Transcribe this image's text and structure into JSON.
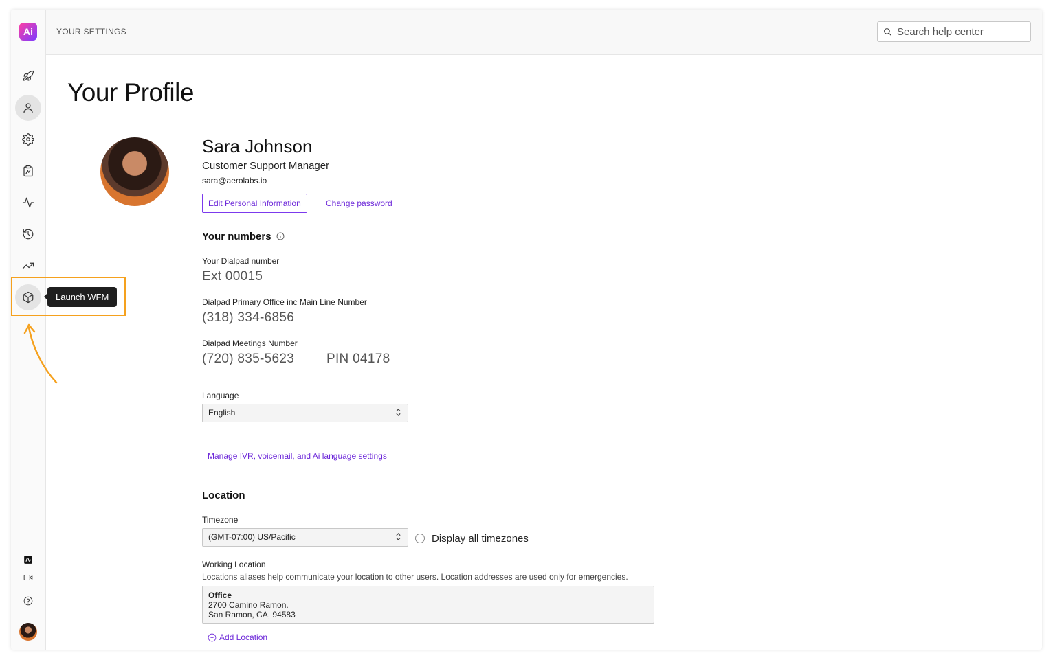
{
  "topbar": {
    "breadcrumb": "YOUR SETTINGS",
    "search_placeholder": "Search help center"
  },
  "sidebar": {
    "logo": "Ai",
    "items": [
      {
        "icon": "rocket-icon"
      },
      {
        "icon": "user-icon",
        "active": true
      },
      {
        "icon": "gear-icon"
      },
      {
        "icon": "clipboard-icon"
      },
      {
        "icon": "activity-icon"
      },
      {
        "icon": "history-icon"
      },
      {
        "icon": "trending-up-icon"
      },
      {
        "icon": "cube-icon",
        "active": true
      }
    ],
    "tooltip": "Launch WFM"
  },
  "page": {
    "title": "Your Profile"
  },
  "profile": {
    "name": "Sara Johnson",
    "role": "Customer Support Manager",
    "email": "sara@aerolabs.io",
    "edit_button": "Edit Personal Information",
    "change_password": "Change password"
  },
  "numbers": {
    "heading": "Your numbers",
    "dialpad_label": "Your Dialpad number",
    "dialpad_value": "Ext 00015",
    "office_label": "Dialpad Primary Office inc Main Line Number",
    "office_value": "(318) 334-6856",
    "meetings_label": "Dialpad Meetings Number",
    "meetings_value": "(720) 835-5623",
    "meetings_pin": "PIN 04178"
  },
  "language": {
    "label": "Language",
    "selected": "English",
    "manage_link": "Manage IVR, voicemail, and Ai language settings"
  },
  "location": {
    "heading": "Location",
    "timezone_label": "Timezone",
    "timezone_selected": "(GMT-07:00) US/Pacific",
    "display_all_label": "Display all timezones",
    "working_label": "Working Location",
    "working_help": "Locations aliases help communicate your location to other users. Location addresses are used only for emergencies.",
    "entry_name": "Office",
    "entry_line1": "2700 Camino Ramon.",
    "entry_line2": "San Ramon, CA, 94583",
    "add_location": "Add Location"
  },
  "colors": {
    "accent": "#6d28d9",
    "highlight": "#f5a11e"
  }
}
